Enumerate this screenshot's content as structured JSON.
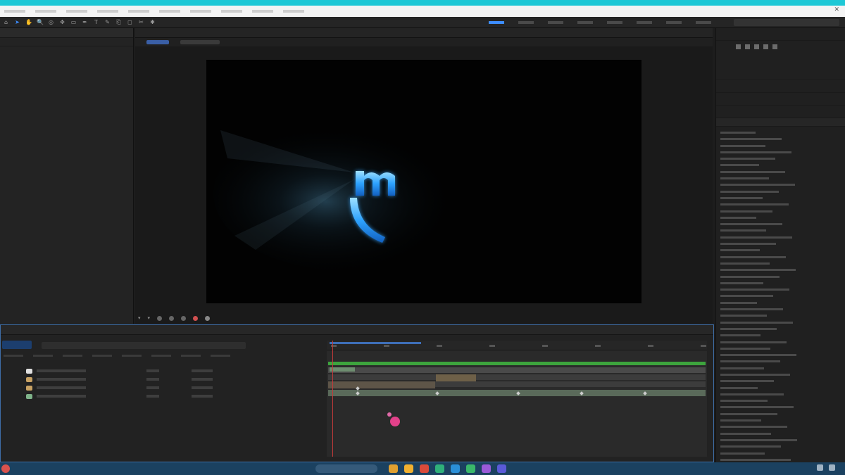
{
  "window": {
    "title": "",
    "close_glyph": "✕",
    "menu": [
      "",
      "",
      "",
      "",
      "",
      "",
      "",
      "",
      "",
      ""
    ]
  },
  "toolbar": {
    "tools": [
      "home-icon",
      "selection-icon",
      "hand-icon",
      "zoom-icon",
      "camera-icon",
      "pan-icon",
      "rect-icon",
      "pen-icon",
      "text-icon",
      "brush-icon",
      "stamp-icon",
      "eraser-icon",
      "roto-icon",
      "puppet-icon"
    ],
    "workspaces": [
      "",
      "",
      "",
      "",
      "",
      "",
      "",
      ""
    ],
    "search_placeholder": ""
  },
  "project_panel": {
    "tab": ""
  },
  "composition": {
    "tab_labels": [
      "",
      ""
    ],
    "logo_letter": "m",
    "accent": "#39a7ff"
  },
  "effects_panel": {
    "title": "",
    "items": [
      "",
      "",
      "",
      "",
      "",
      "",
      "",
      "",
      "",
      "",
      "",
      "",
      "",
      "",
      "",
      "",
      "",
      "",
      "",
      "",
      "",
      "",
      "",
      "",
      "",
      "",
      "",
      "",
      "",
      "",
      "",
      "",
      "",
      "",
      "",
      "",
      "",
      "",
      "",
      "",
      "",
      "",
      "",
      "",
      "",
      "",
      "",
      "",
      "",
      "",
      ""
    ]
  },
  "timeline": {
    "tab_labels": [
      "",
      ""
    ],
    "timecode": "",
    "columns": [
      "",
      "",
      "",
      "",
      "",
      "",
      "",
      ""
    ],
    "layers": [
      {
        "name": "",
        "color": "#e0e0e0",
        "mode": "",
        "parent": ""
      },
      {
        "name": "",
        "color": "#c8a264",
        "mode": "",
        "parent": ""
      },
      {
        "name": "",
        "color": "#c8a264",
        "mode": "",
        "parent": ""
      },
      {
        "name": "",
        "color": "#7fb38a",
        "mode": "",
        "parent": ""
      }
    ],
    "tick_labels": [
      "",
      "",
      "",
      "",
      "",
      "",
      "",
      ""
    ]
  },
  "footer": {
    "status": ""
  },
  "taskbar": {
    "weather": "",
    "search_placeholder": "",
    "clock": "",
    "app_colors": [
      "#e0a030",
      "#f0b030",
      "#d94a3a",
      "#2fb07a",
      "#2a8fd8",
      "#3ab86a",
      "#9a5ad8",
      "#5a5ad8"
    ]
  }
}
